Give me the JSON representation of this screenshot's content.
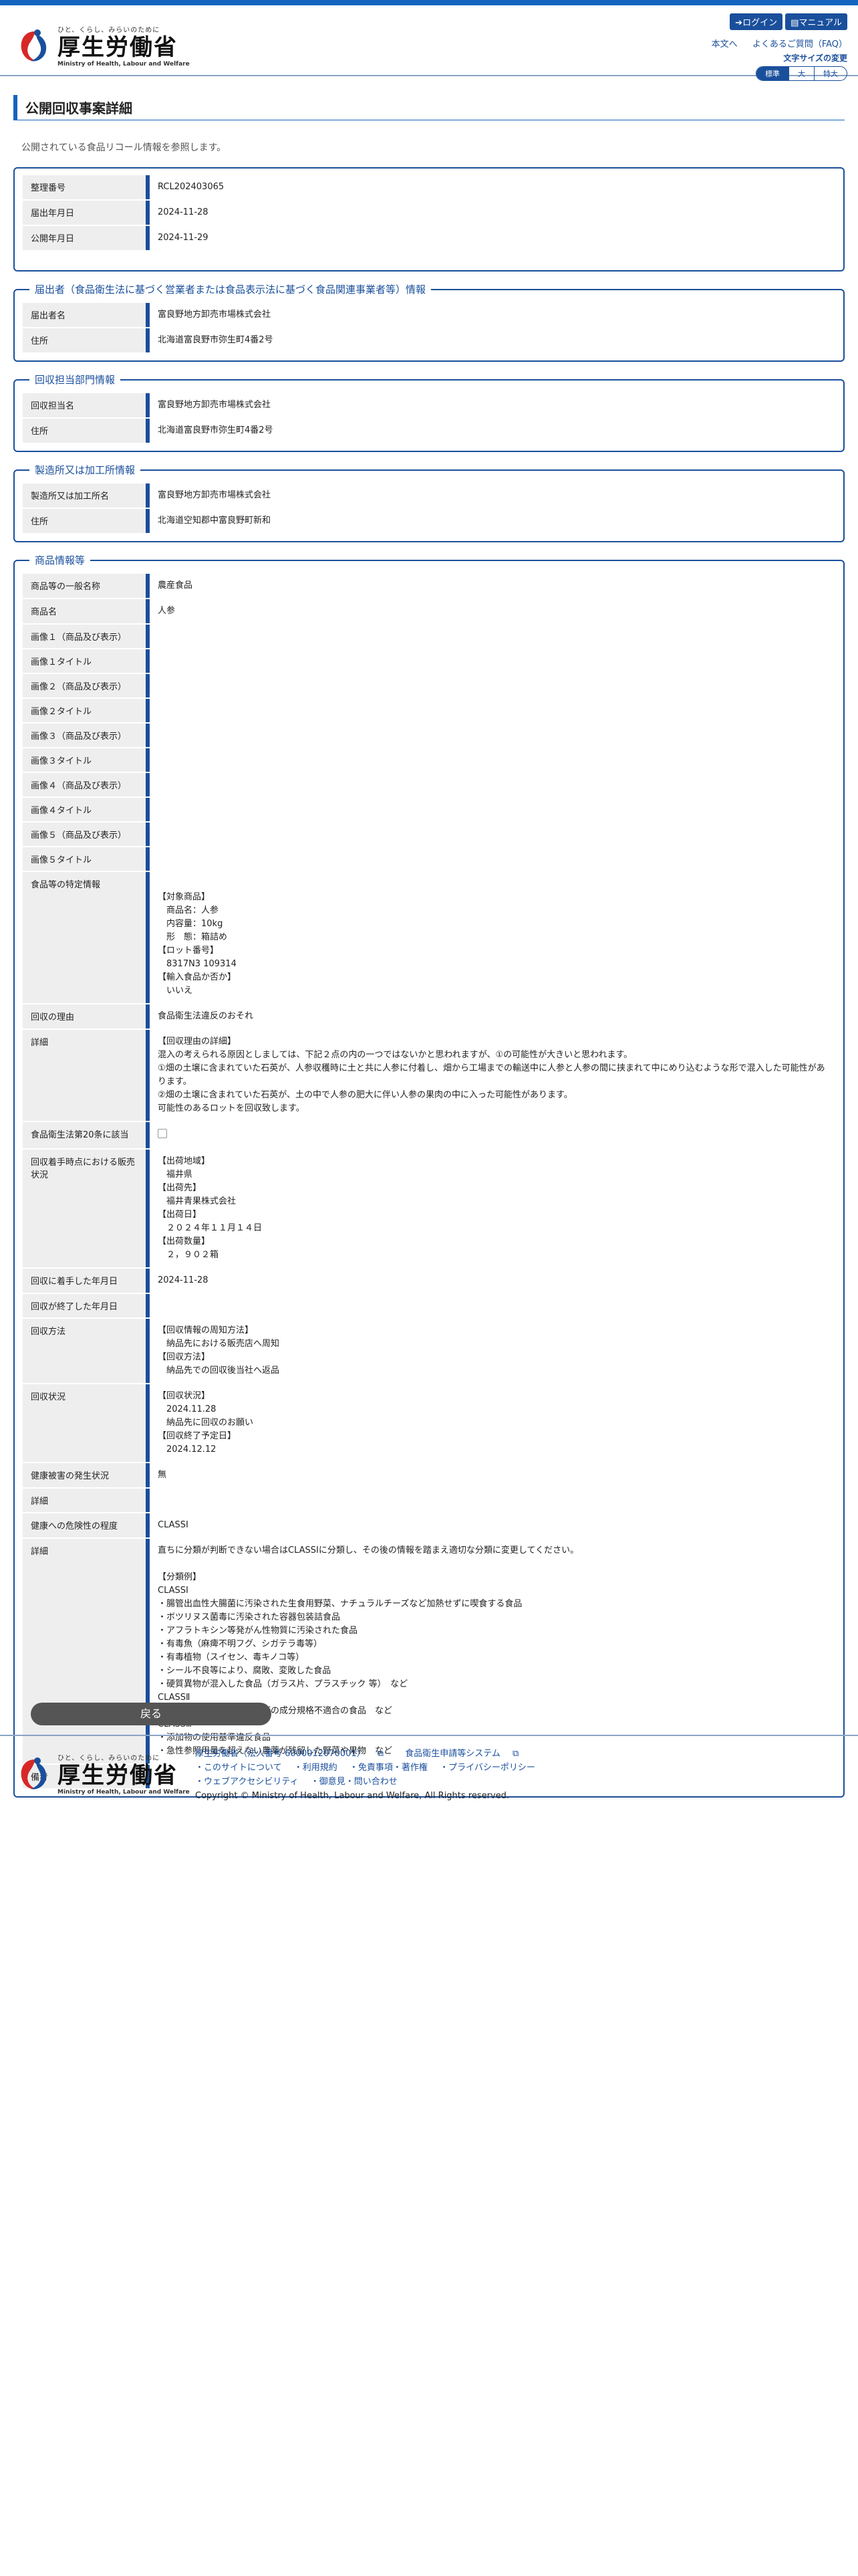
{
  "header": {
    "logo_tagline": "ひと、くらし、みらいのために",
    "logo_jp": "厚生労働省",
    "logo_en": "Ministry of Health, Labour and Welfare",
    "login_label": "ログイン",
    "manual_label": "マニュアル",
    "to_body_link": "本文へ",
    "faq_link": "よくあるご質問（FAQ）",
    "font_size_label": "文字サイズの変更",
    "font_sizes": [
      "標準",
      "大",
      "特大"
    ]
  },
  "page": {
    "title": "公開回収事案詳細",
    "intro": "公開されている食品リコール情報を参照します。"
  },
  "basic": {
    "rows": [
      {
        "label": "整理番号",
        "value": "RCL202403065"
      },
      {
        "label": "届出年月日",
        "value": "2024-11-28"
      },
      {
        "label": "公開年月日",
        "value": "2024-11-29"
      }
    ]
  },
  "notifier": {
    "legend": "届出者（食品衛生法に基づく営業者または食品表示法に基づく食品関連事業者等）情報",
    "rows": [
      {
        "label": "届出者名",
        "value": "富良野地方卸売市場株式会社"
      },
      {
        "label": "住所",
        "value": "北海道富良野市弥生町4番2号"
      }
    ]
  },
  "recall_dept": {
    "legend": "回収担当部門情報",
    "rows": [
      {
        "label": "回収担当名",
        "value": "富良野地方卸売市場株式会社"
      },
      {
        "label": "住所",
        "value": "北海道富良野市弥生町4番2号"
      }
    ]
  },
  "factory": {
    "legend": "製造所又は加工所情報",
    "rows": [
      {
        "label": "製造所又は加工所名",
        "value": "富良野地方卸売市場株式会社"
      },
      {
        "label": "住所",
        "value": "北海道空知郡中富良野町新和"
      }
    ]
  },
  "product": {
    "legend": "商品情報等",
    "general_name": {
      "label": "商品等の一般名称",
      "value": "農産食品"
    },
    "name": {
      "label": "商品名",
      "value": "人参"
    },
    "images": [
      {
        "label": "画像１（商品及び表示）",
        "value": ""
      },
      {
        "label": "画像１タイトル",
        "value": ""
      },
      {
        "label": "画像２（商品及び表示）",
        "value": ""
      },
      {
        "label": "画像２タイトル",
        "value": ""
      },
      {
        "label": "画像３（商品及び表示）",
        "value": ""
      },
      {
        "label": "画像３タイトル",
        "value": ""
      },
      {
        "label": "画像４（商品及び表示）",
        "value": ""
      },
      {
        "label": "画像４タイトル",
        "value": ""
      },
      {
        "label": "画像５（商品及び表示）",
        "value": ""
      },
      {
        "label": "画像５タイトル",
        "value": ""
      }
    ],
    "identification": {
      "label": "食品等の特定情報",
      "value": "\n【対象商品】\n　商品名：人参\n　内容量：10kg\n　形　態：箱詰め\n【ロット番号】\n　8317N3 109314\n【輸入食品か否か】\n　いいえ"
    },
    "reason": {
      "label": "回収の理由",
      "value": "食品衛生法違反のおそれ"
    },
    "detail": {
      "label": "詳細",
      "value": "【回収理由の詳細】\n混入の考えられる原因としましては、下記２点の内の一つではないかと思われますが、①の可能性が大きいと思われます。\n①畑の土壌に含まれていた石英が、人参収穫時に土と共に人参に付着し、畑から工場までの輸送中に人参と人参の間に挟まれて中にめり込むような形で混入した可能性があります。\n②畑の土壌に含まれていた石英が、土の中で人参の肥大に伴い人参の果肉の中に入った可能性があります。\n可能性のあるロットを回収致します。"
    },
    "article20": {
      "label": "食品衛生法第20条に該当"
    },
    "sales_status": {
      "label": "回収着手時点における販売状況",
      "value": "【出荷地域】\n　福井県\n【出荷先】\n　福井青果株式会社\n【出荷日】\n　２０２４年１１月１４日\n【出荷数量】\n　２，９０２箱"
    },
    "start_date": {
      "label": "回収に着手した年月日",
      "value": "2024-11-28"
    },
    "end_date": {
      "label": "回収が終了した年月日",
      "value": ""
    },
    "method": {
      "label": "回収方法",
      "value": "【回収情報の周知方法】\n　納品先における販売店へ周知\n【回収方法】\n　納品先での回収後当社へ返品"
    },
    "status": {
      "label": "回収状況",
      "value": "【回収状況】\n　2024.11.28\n　納品先に回収のお願い\n【回収終了予定日】\n　2024.12.12"
    },
    "health_damage": {
      "label": "健康被害の発生状況",
      "value": "無"
    },
    "health_detail": {
      "label": "詳細",
      "value": ""
    },
    "risk_level": {
      "label": "健康への危険性の程度",
      "value": "CLASSⅠ"
    },
    "risk_detail": {
      "label": "詳細",
      "value": "直ちに分類が判断できない場合はCLASSⅠに分類し、その後の情報を踏まえ適切な分類に変更してください。\n\n【分類例】\nCLASSⅠ\n・腸管出血性大腸菌に汚染された生食用野菜、ナチュラルチーズなど加熱せずに喫食する食品\n・ボツリヌス菌毒に汚染された容器包装詰食品\n・アフラトキシン等発がん性物質に汚染された食品\n・有毒魚（麻痺不明フグ、シガテラ毒等）\n・有毒植物（スイセン、毒キノコ等）\n・シール不良等により、腐敗、変敗した食品\n・硬質異物が混入した食品（ガラス片、プラスチック 等）　など\nCLASSⅡ\n・一般細菌数や大腸菌群などの成分規格不適合の食品　など\nCLASSⅢ\n・添加物の使用基準違反食品\n・急性参照用量を超えない農薬が残留した野菜や果物　など"
    },
    "remarks": {
      "label": "備考",
      "value": ""
    }
  },
  "back_button": "戻る",
  "footer": {
    "org_line": "厚生労働省（法人番号 6000012070001）",
    "system_link": "食品衛生申請等システム",
    "links1": [
      "・このサイトについて",
      "・利用規約",
      "・免責事項・著作権",
      "・プライバシーポリシー"
    ],
    "links2": [
      "・ウェブアクセシビリティ",
      "・御意見・問い合わせ"
    ],
    "copyright": "Copyright © Ministry of Health, Labour and Welfare, All Rights reserved."
  },
  "colors": {
    "accent": "#1a4f9c",
    "topbar": "#1565c0",
    "back_button": "#555555"
  }
}
